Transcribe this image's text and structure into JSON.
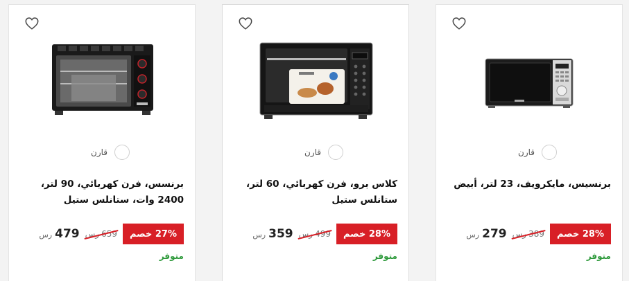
{
  "products": [
    {
      "title": "برنسيس، مايكرويف، 23 لتر، أبيض",
      "discount": "28% خصم",
      "old_price": "389",
      "new_price": "279",
      "currency": "رس",
      "compare_label": "قارن",
      "stock": "متوفر"
    },
    {
      "title": "كلاس برو، فرن كهربائي، 60 لتر، ستانلس ستيل",
      "discount": "28% خصم",
      "old_price": "499",
      "new_price": "359",
      "currency": "رس",
      "compare_label": "قارن",
      "stock": "متوفر"
    },
    {
      "title": "برنسس، فرن كهربائي، 90 لتر، 2400 وات، ستانلس ستيل",
      "discount": "27% خصم",
      "old_price": "659",
      "new_price": "479",
      "currency": "رس",
      "compare_label": "قارن",
      "stock": "متوفر"
    }
  ],
  "colors": {
    "badge": "#d81f26",
    "stock": "#2f9a3c"
  },
  "icons": {
    "wishlist": "heart-outline-icon",
    "compare": "circle-checkbox-icon"
  }
}
